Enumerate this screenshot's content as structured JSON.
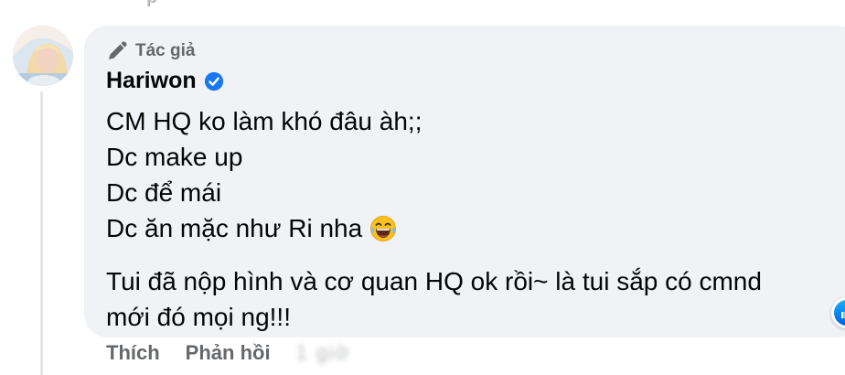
{
  "top_remnant": "p",
  "comment": {
    "author_badge": "Tác giả",
    "author_name": "Hariwon",
    "lines": [
      "CM HQ ko làm khó đâu àh;;",
      "Dc make up",
      "Dc để mái",
      "Dc ăn mặc như Ri nha"
    ],
    "paragraph2": [
      "Tui đã nộp hình và cơ quan HQ ok rồi~ là tui sắp có cmnd",
      "mới đó mọi ng!!!"
    ],
    "emoji": "laughing-tears-emoji",
    "reaction": "like-icon"
  },
  "actions": {
    "like": "Thích",
    "reply": "Phản hồi",
    "time_blurred": "1 giờ"
  },
  "colors": {
    "bubble": "#f0f2f5",
    "muted_text": "#65676b",
    "verified": "#1877f2",
    "like_blue": "#1877f2"
  }
}
